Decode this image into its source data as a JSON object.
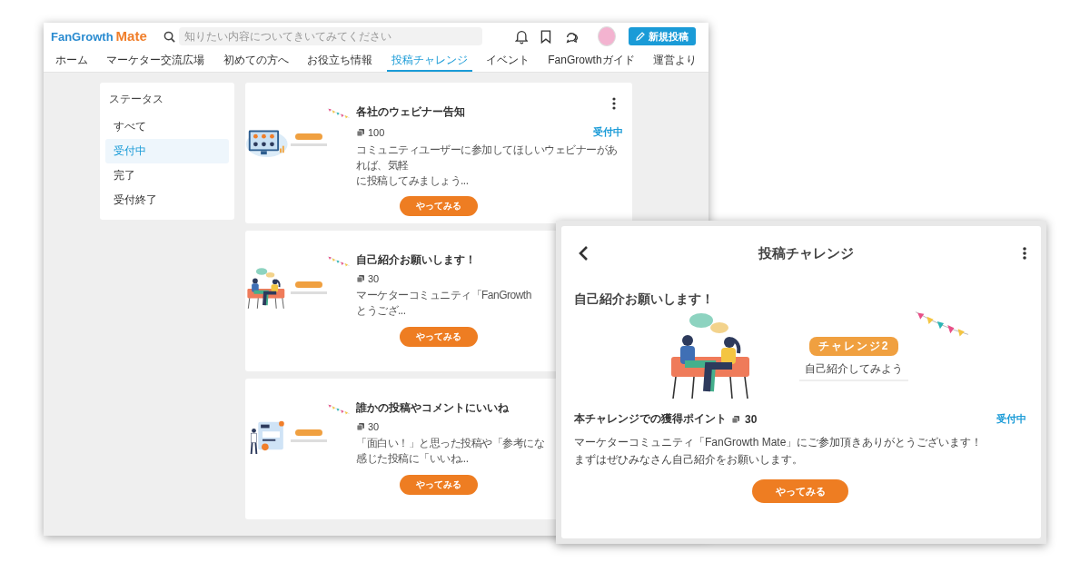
{
  "header": {
    "logo": {
      "name": "FanGrowth",
      "suffix": "Mate"
    },
    "search": {
      "placeholder": "知りたい内容についてきいてみてください"
    },
    "new_post_button": "新規投稿"
  },
  "nav_tabs": [
    {
      "label": "ホーム",
      "selected": false
    },
    {
      "label": "マーケター交流広場",
      "selected": false
    },
    {
      "label": "初めての方へ",
      "selected": false
    },
    {
      "label": "お役立ち情報",
      "selected": false
    },
    {
      "label": "投稿チャレンジ",
      "selected": true
    },
    {
      "label": "イベント",
      "selected": false
    },
    {
      "label": "FanGrowthガイド",
      "selected": false
    },
    {
      "label": "運営より",
      "selected": false
    }
  ],
  "sidebar": {
    "title": "ステータス",
    "items": [
      {
        "label": "すべて",
        "selected": false
      },
      {
        "label": "受付中",
        "selected": true
      },
      {
        "label": "完了",
        "selected": false
      },
      {
        "label": "受付終了",
        "selected": false
      }
    ]
  },
  "challenges": [
    {
      "title": "各社のウェビナー告知",
      "points": "100",
      "status": "受付中",
      "has_menu": true,
      "description_lines": [
        "コミュニティユーザーに参加してほしいウェビナーがあれば、気軽",
        "に投稿してみましょう..."
      ],
      "button": "やってみる"
    },
    {
      "title": "自己紹介お願いします！",
      "points": "30",
      "has_menu": false,
      "description_lines": [
        "マーケターコミュニティ「FanGrowth",
        "とうござ..."
      ],
      "button": "やってみる"
    },
    {
      "title": "誰かの投稿やコメントにいいね",
      "points": "30",
      "has_menu": false,
      "description_lines": [
        "「面白い！」と思った投稿や「参考にな",
        "感じた投稿に「いいね..."
      ],
      "button": "やってみる"
    }
  ],
  "detail": {
    "header_title": "投稿チャレンジ",
    "title": "自己紹介お願いします！",
    "banner": {
      "badge": "チャレンジ2",
      "caption": "自己紹介してみよう"
    },
    "points_label": "本チャレンジでの獲得ポイント",
    "points": "30",
    "status": "受付中",
    "description_lines": [
      "マーケターコミュニティ「FanGrowth Mate」にご参加頂きありがとうございます！",
      "まずはぜひみなさん自己紹介をお願いします。"
    ],
    "button": "やってみる"
  }
}
